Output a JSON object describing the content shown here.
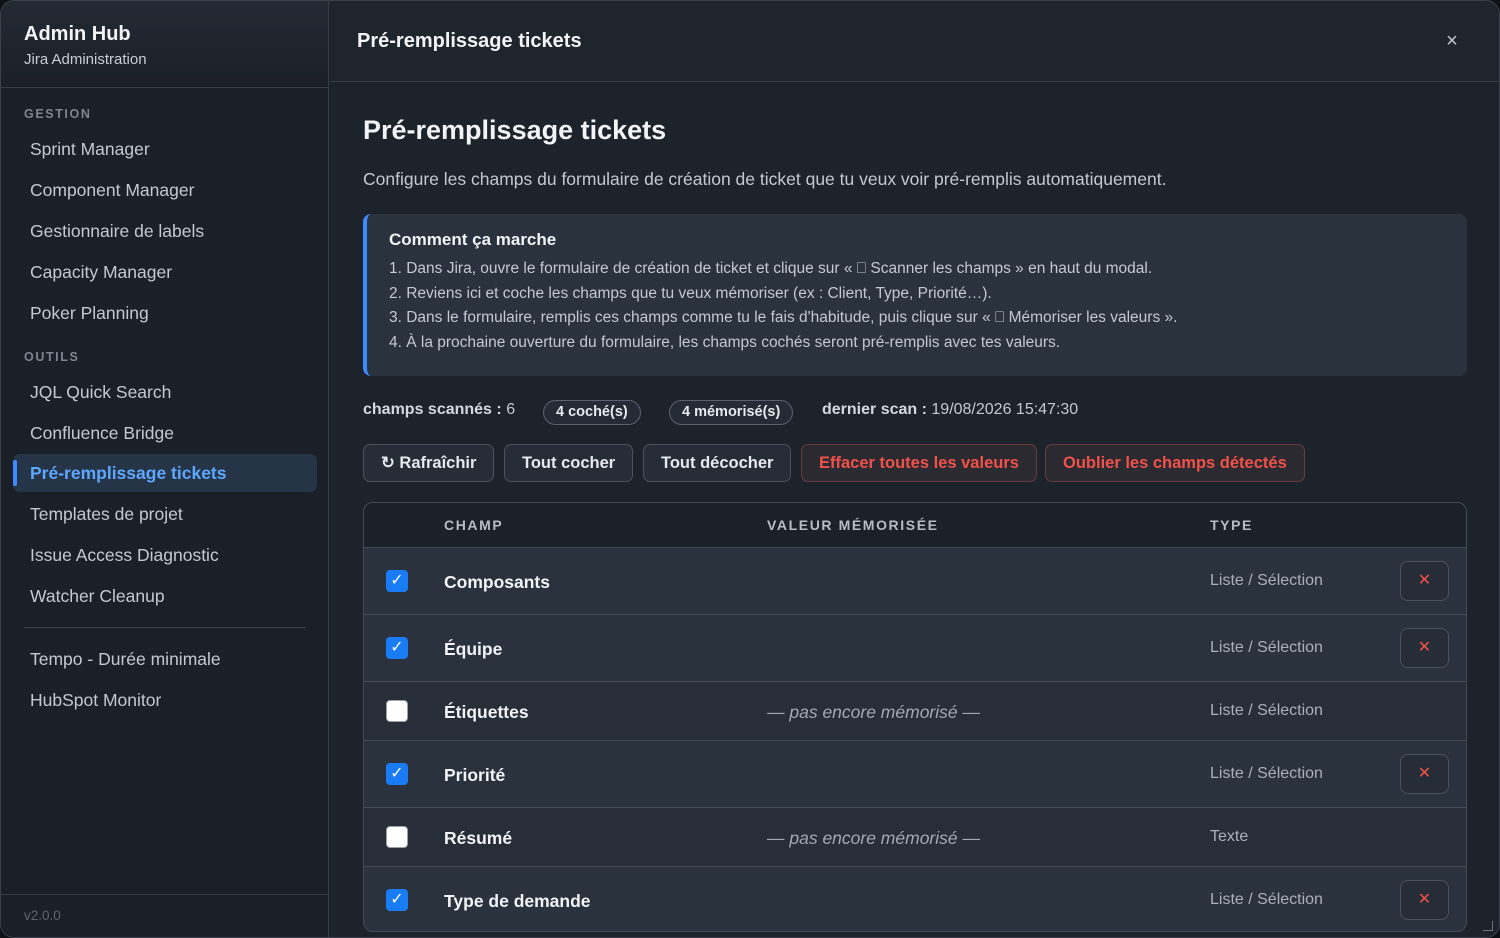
{
  "brand": {
    "title": "Admin Hub",
    "subtitle": "Jira Administration"
  },
  "sidebar": {
    "sections": [
      {
        "label": "GESTION",
        "items": [
          "Sprint Manager",
          "Component Manager",
          "Gestionnaire de labels",
          "Capacity Manager",
          "Poker Planning"
        ]
      },
      {
        "label": "OUTILS",
        "items": [
          "JQL Quick Search",
          "Confluence Bridge",
          "Pré-remplissage tickets",
          "Templates de projet",
          "Issue Access Diagnostic",
          "Watcher Cleanup"
        ]
      }
    ],
    "extra_items": [
      "Tempo - Durée minimale",
      "HubSpot Monitor"
    ],
    "active_item": "Pré-remplissage tickets",
    "version": "v2.0.0"
  },
  "header": {
    "title": "Pré-remplissage tickets",
    "close_label": "×"
  },
  "page": {
    "title": "Pré-remplissage tickets",
    "description": "Configure les champs du formulaire de création de ticket que tu veux voir pré-remplis automatiquement."
  },
  "info": {
    "title": "Comment ça marche",
    "lines": [
      "1. Dans Jira, ouvre le formulaire de création de ticket et clique sur « ⎕ Scanner les champs » en haut du modal.",
      "2. Reviens ici et coche les champs que tu veux mémoriser (ex : Client, Type, Priorité…).",
      "3. Dans le formulaire, remplis ces champs comme tu le fais d'habitude, puis clique sur « ⎕ Mémoriser les valeurs ».",
      "4. À la prochaine ouverture du formulaire, les champs cochés seront pré-remplis avec tes valeurs."
    ]
  },
  "stats": {
    "scanned_label": "champs scannés :",
    "scanned_value": "6",
    "checked_pill": "4 coché(s)",
    "memorized_pill": "4 mémorisé(s)",
    "last_scan_label": "dernier scan :",
    "last_scan_value": "19/08/2026 15:47:30"
  },
  "actions": {
    "refresh": "↻ Rafraîchir",
    "check_all": "Tout cocher",
    "uncheck_all": "Tout décocher",
    "clear_values": "Effacer toutes les valeurs",
    "forget_fields": "Oublier les champs détectés"
  },
  "table": {
    "headers": {
      "field": "CHAMP",
      "value": "VALEUR MÉMORISÉE",
      "type": "TYPE"
    },
    "rows": [
      {
        "checked": true,
        "name": "Composants",
        "value": "",
        "type": "Liste / Sélection",
        "delete": "✕"
      },
      {
        "checked": true,
        "name": "Équipe",
        "value": "",
        "type": "Liste / Sélection",
        "delete": "✕"
      },
      {
        "checked": false,
        "name": "Étiquettes",
        "value": "— pas encore mémorisé —",
        "type": "Liste / Sélection",
        "delete": ""
      },
      {
        "checked": true,
        "name": "Priorité",
        "value": "",
        "type": "Liste / Sélection",
        "delete": "✕"
      },
      {
        "checked": false,
        "name": "Résumé",
        "value": "— pas encore mémorisé —",
        "type": "Texte",
        "delete": ""
      },
      {
        "checked": true,
        "name": "Type de demande",
        "value": "",
        "type": "Liste / Sélection",
        "delete": "✕"
      }
    ]
  },
  "colors": {
    "accent": "#3d8bff",
    "danger": "#f0514a",
    "checkbox": "#1a7cf5"
  }
}
